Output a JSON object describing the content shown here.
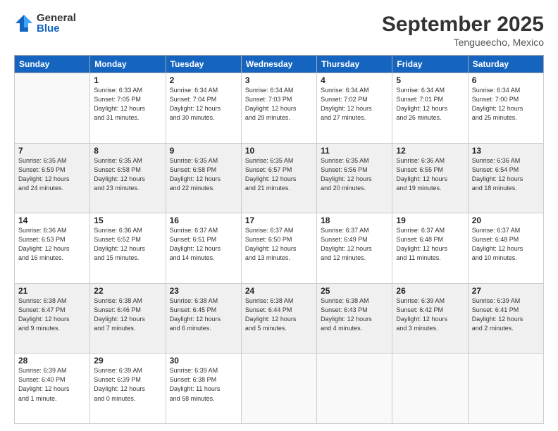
{
  "logo": {
    "general": "General",
    "blue": "Blue"
  },
  "header": {
    "month": "September 2025",
    "location": "Tengueecho, Mexico"
  },
  "weekdays": [
    "Sunday",
    "Monday",
    "Tuesday",
    "Wednesday",
    "Thursday",
    "Friday",
    "Saturday"
  ],
  "weeks": [
    [
      {
        "day": "",
        "info": ""
      },
      {
        "day": "1",
        "info": "Sunrise: 6:33 AM\nSunset: 7:05 PM\nDaylight: 12 hours\nand 31 minutes."
      },
      {
        "day": "2",
        "info": "Sunrise: 6:34 AM\nSunset: 7:04 PM\nDaylight: 12 hours\nand 30 minutes."
      },
      {
        "day": "3",
        "info": "Sunrise: 6:34 AM\nSunset: 7:03 PM\nDaylight: 12 hours\nand 29 minutes."
      },
      {
        "day": "4",
        "info": "Sunrise: 6:34 AM\nSunset: 7:02 PM\nDaylight: 12 hours\nand 27 minutes."
      },
      {
        "day": "5",
        "info": "Sunrise: 6:34 AM\nSunset: 7:01 PM\nDaylight: 12 hours\nand 26 minutes."
      },
      {
        "day": "6",
        "info": "Sunrise: 6:34 AM\nSunset: 7:00 PM\nDaylight: 12 hours\nand 25 minutes."
      }
    ],
    [
      {
        "day": "7",
        "info": "Sunrise: 6:35 AM\nSunset: 6:59 PM\nDaylight: 12 hours\nand 24 minutes."
      },
      {
        "day": "8",
        "info": "Sunrise: 6:35 AM\nSunset: 6:58 PM\nDaylight: 12 hours\nand 23 minutes."
      },
      {
        "day": "9",
        "info": "Sunrise: 6:35 AM\nSunset: 6:58 PM\nDaylight: 12 hours\nand 22 minutes."
      },
      {
        "day": "10",
        "info": "Sunrise: 6:35 AM\nSunset: 6:57 PM\nDaylight: 12 hours\nand 21 minutes."
      },
      {
        "day": "11",
        "info": "Sunrise: 6:35 AM\nSunset: 6:56 PM\nDaylight: 12 hours\nand 20 minutes."
      },
      {
        "day": "12",
        "info": "Sunrise: 6:36 AM\nSunset: 6:55 PM\nDaylight: 12 hours\nand 19 minutes."
      },
      {
        "day": "13",
        "info": "Sunrise: 6:36 AM\nSunset: 6:54 PM\nDaylight: 12 hours\nand 18 minutes."
      }
    ],
    [
      {
        "day": "14",
        "info": "Sunrise: 6:36 AM\nSunset: 6:53 PM\nDaylight: 12 hours\nand 16 minutes."
      },
      {
        "day": "15",
        "info": "Sunrise: 6:36 AM\nSunset: 6:52 PM\nDaylight: 12 hours\nand 15 minutes."
      },
      {
        "day": "16",
        "info": "Sunrise: 6:37 AM\nSunset: 6:51 PM\nDaylight: 12 hours\nand 14 minutes."
      },
      {
        "day": "17",
        "info": "Sunrise: 6:37 AM\nSunset: 6:50 PM\nDaylight: 12 hours\nand 13 minutes."
      },
      {
        "day": "18",
        "info": "Sunrise: 6:37 AM\nSunset: 6:49 PM\nDaylight: 12 hours\nand 12 minutes."
      },
      {
        "day": "19",
        "info": "Sunrise: 6:37 AM\nSunset: 6:48 PM\nDaylight: 12 hours\nand 11 minutes."
      },
      {
        "day": "20",
        "info": "Sunrise: 6:37 AM\nSunset: 6:48 PM\nDaylight: 12 hours\nand 10 minutes."
      }
    ],
    [
      {
        "day": "21",
        "info": "Sunrise: 6:38 AM\nSunset: 6:47 PM\nDaylight: 12 hours\nand 9 minutes."
      },
      {
        "day": "22",
        "info": "Sunrise: 6:38 AM\nSunset: 6:46 PM\nDaylight: 12 hours\nand 7 minutes."
      },
      {
        "day": "23",
        "info": "Sunrise: 6:38 AM\nSunset: 6:45 PM\nDaylight: 12 hours\nand 6 minutes."
      },
      {
        "day": "24",
        "info": "Sunrise: 6:38 AM\nSunset: 6:44 PM\nDaylight: 12 hours\nand 5 minutes."
      },
      {
        "day": "25",
        "info": "Sunrise: 6:38 AM\nSunset: 6:43 PM\nDaylight: 12 hours\nand 4 minutes."
      },
      {
        "day": "26",
        "info": "Sunrise: 6:39 AM\nSunset: 6:42 PM\nDaylight: 12 hours\nand 3 minutes."
      },
      {
        "day": "27",
        "info": "Sunrise: 6:39 AM\nSunset: 6:41 PM\nDaylight: 12 hours\nand 2 minutes."
      }
    ],
    [
      {
        "day": "28",
        "info": "Sunrise: 6:39 AM\nSunset: 6:40 PM\nDaylight: 12 hours\nand 1 minute."
      },
      {
        "day": "29",
        "info": "Sunrise: 6:39 AM\nSunset: 6:39 PM\nDaylight: 12 hours\nand 0 minutes."
      },
      {
        "day": "30",
        "info": "Sunrise: 6:39 AM\nSunset: 6:38 PM\nDaylight: 11 hours\nand 58 minutes."
      },
      {
        "day": "",
        "info": ""
      },
      {
        "day": "",
        "info": ""
      },
      {
        "day": "",
        "info": ""
      },
      {
        "day": "",
        "info": ""
      }
    ]
  ]
}
